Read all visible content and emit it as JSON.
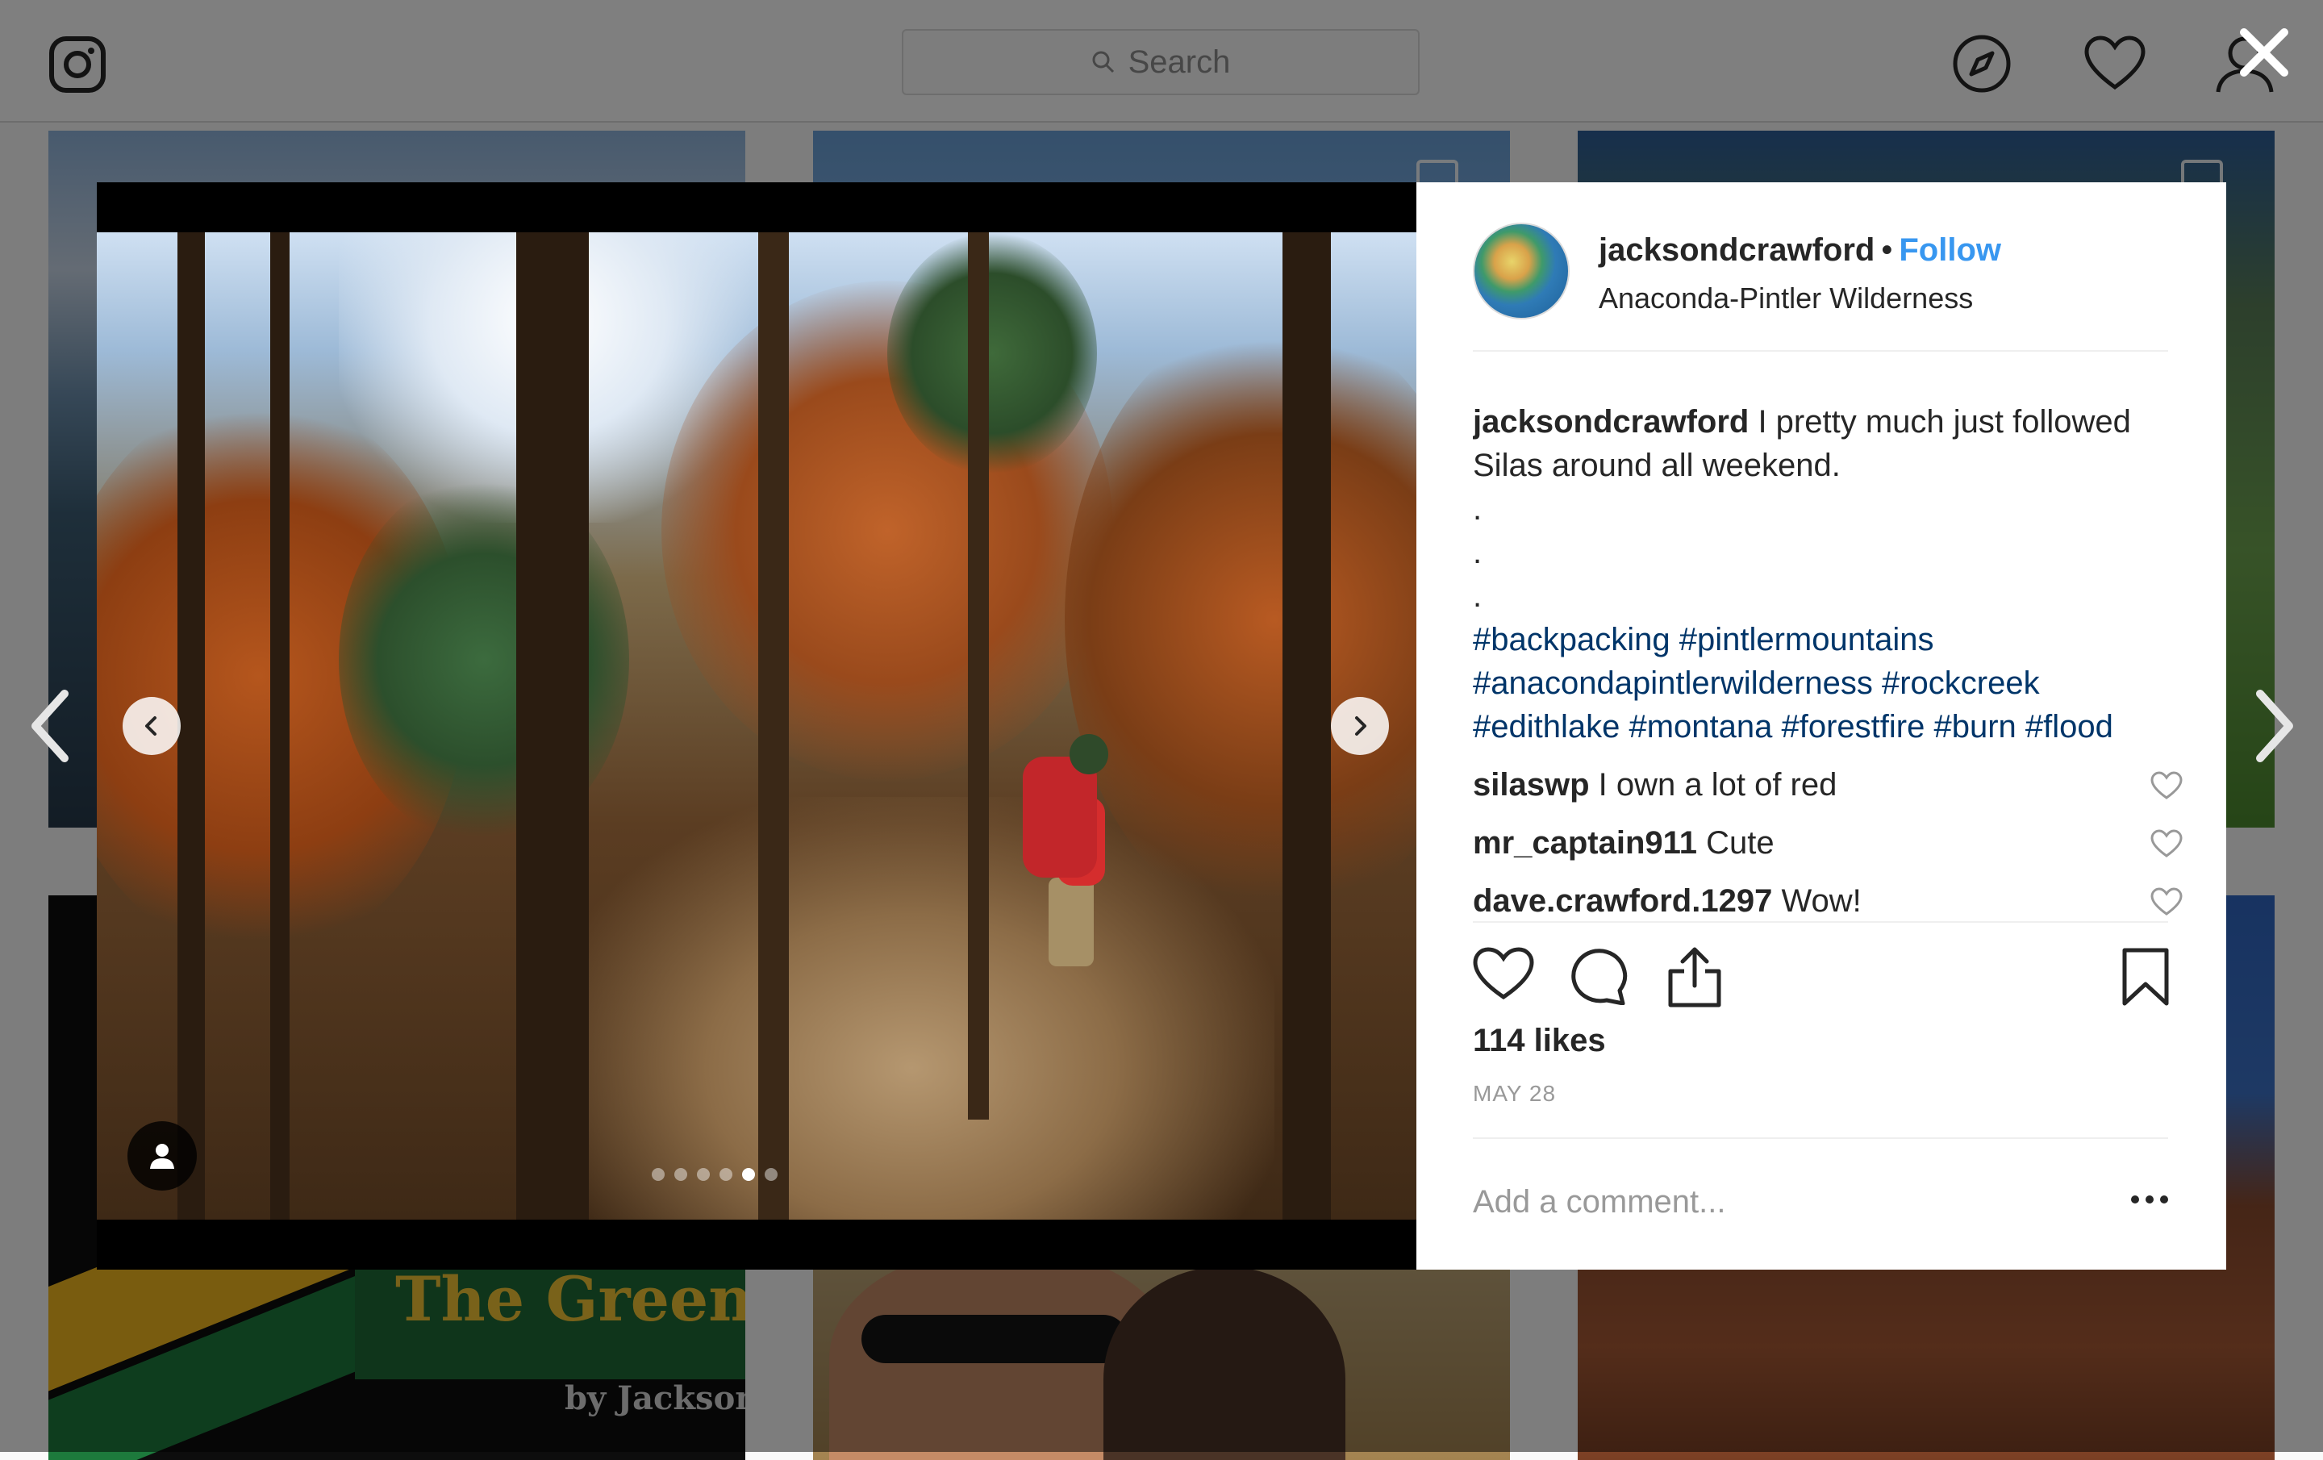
{
  "header": {
    "search_placeholder": "Search"
  },
  "background_tiles": {
    "tile4_title": "The Green",
    "tile4_byline": "by Jackson"
  },
  "post": {
    "username": "jacksondcrawford",
    "separator": "•",
    "follow_label": "Follow",
    "location": "Anaconda-Pintler Wilderness",
    "caption_username": "jacksondcrawford",
    "caption_text": "I pretty much just followed Silas around all weekend.",
    "caption_dots": [
      ".",
      ".",
      "."
    ],
    "hashtags": "#backpacking #pintlermountains #anacondapintlerwilderness #rockcreek #edithlake #montana #forestfire #burn #flood",
    "comments": [
      {
        "user": "silaswp",
        "text": "I own a lot of red"
      },
      {
        "user": "mr_captain911",
        "text": "Cute"
      },
      {
        "user": "dave.crawford.1297",
        "text": "Wow!"
      }
    ],
    "likes": "114 likes",
    "date": "MAY 28",
    "add_comment_placeholder": "Add a comment...",
    "carousel": {
      "slide_count": 6,
      "active_index": 4
    }
  },
  "icons": {
    "header": [
      "instagram-logo-icon",
      "compass-icon",
      "heart-icon",
      "profile-icon"
    ],
    "actions": [
      "like-icon",
      "comment-icon",
      "share-icon",
      "bookmark-icon"
    ]
  },
  "colors": {
    "follow": "#3897f0",
    "hashtag": "#003569",
    "text": "#262626",
    "muted": "#999999"
  }
}
